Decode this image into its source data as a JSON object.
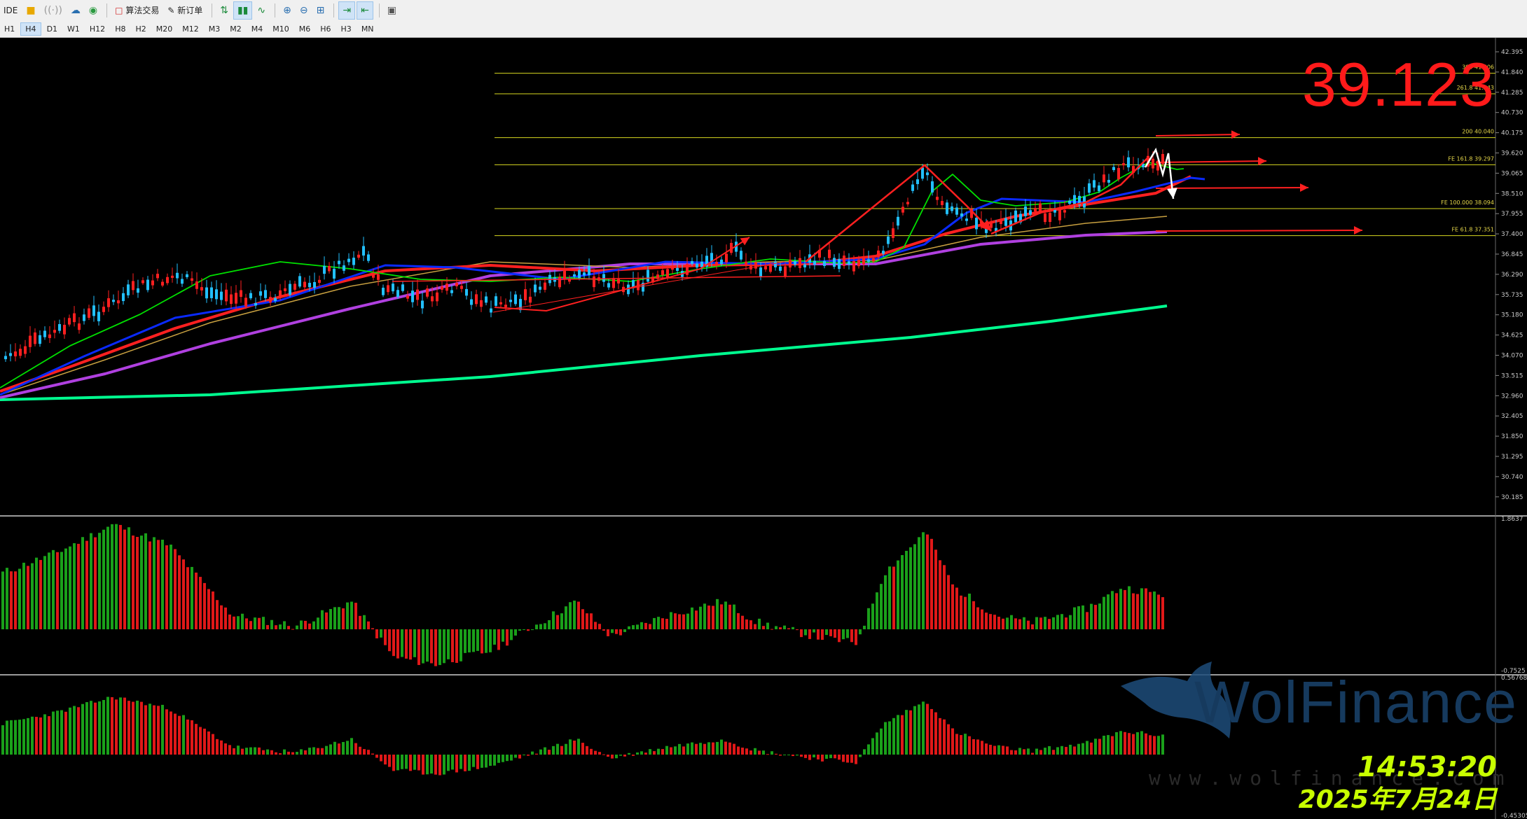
{
  "toolbar": {
    "ide_label": "IDE",
    "algo_label": "算法交易",
    "new_order_label": "新订单"
  },
  "timeframes": [
    "H1",
    "H4",
    "D1",
    "W1",
    "H12",
    "H8",
    "H2",
    "M20",
    "M12",
    "M3",
    "M2",
    "M4",
    "M10",
    "M6",
    "H6",
    "H3",
    "MN"
  ],
  "active_timeframe": "H4",
  "price_axis": [
    "42.395",
    "41.840",
    "41.285",
    "40.730",
    "40.175",
    "39.620",
    "39.065",
    "38.510",
    "37.955",
    "37.400",
    "36.845",
    "36.290",
    "35.735",
    "35.180",
    "34.625",
    "34.070",
    "33.515",
    "32.960",
    "32.405",
    "31.850",
    "31.295",
    "30.740",
    "30.185"
  ],
  "macd_axis": {
    "top": "1.8637",
    "bottom": "-0.7525"
  },
  "osc_axis": {
    "top": "0.56768",
    "bottom": "-0.45305"
  },
  "fib_levels": [
    {
      "label": "300",
      "value": "41.806",
      "price": 41.806
    },
    {
      "label": "261.8",
      "value": "41.243",
      "price": 41.243
    },
    {
      "label": "200",
      "value": "40.040",
      "price": 40.04
    },
    {
      "label": "FE 161.8",
      "value": "39.297",
      "price": 39.297
    },
    {
      "label": "FE 100.000",
      "value": "38.094",
      "price": 38.094
    },
    {
      "label": "FE 61.8",
      "value": "37.351",
      "price": 37.351
    }
  ],
  "current_price_display": "39.123",
  "watermark": {
    "brand": "WolFinance",
    "url": "www.wolfinance.com"
  },
  "clock": {
    "time": "14:53:20",
    "date": "2025年7月24日"
  },
  "colors": {
    "bull": "#22c0ff",
    "bear": "#ff2020",
    "fib": "#d8d820",
    "ma_green": "#00e000",
    "ma_blue": "#0a2aff",
    "ma_red": "#ff2020",
    "ma_purple": "#b040e0",
    "ma_teal": "#00ff90",
    "ma_tan": "#c8a040",
    "hist_green": "#1aa01a",
    "hist_red": "#e01818",
    "clock": "#c8ff00"
  }
}
